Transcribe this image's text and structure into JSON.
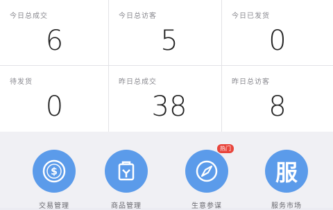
{
  "stats": [
    {
      "label": "今日总成交",
      "value": "6"
    },
    {
      "label": "今日总访客",
      "value": "5"
    },
    {
      "label": "今日已发货",
      "value": "0"
    },
    {
      "label": "待发货",
      "value": "0"
    },
    {
      "label": "昨日总成交",
      "value": "38"
    },
    {
      "label": "昨日总访客",
      "value": "8"
    }
  ],
  "shortcuts": [
    {
      "label": "交易管理",
      "icon": "coin-icon"
    },
    {
      "label": "商品管理",
      "icon": "product-icon"
    },
    {
      "label": "生意参谋",
      "icon": "compass-icon",
      "badge": "热门"
    },
    {
      "label": "服务市场",
      "icon": "fu-service-icon",
      "glyph": "服"
    }
  ],
  "colors": {
    "accent": "#5b9bea",
    "badge": "#e8453c"
  }
}
